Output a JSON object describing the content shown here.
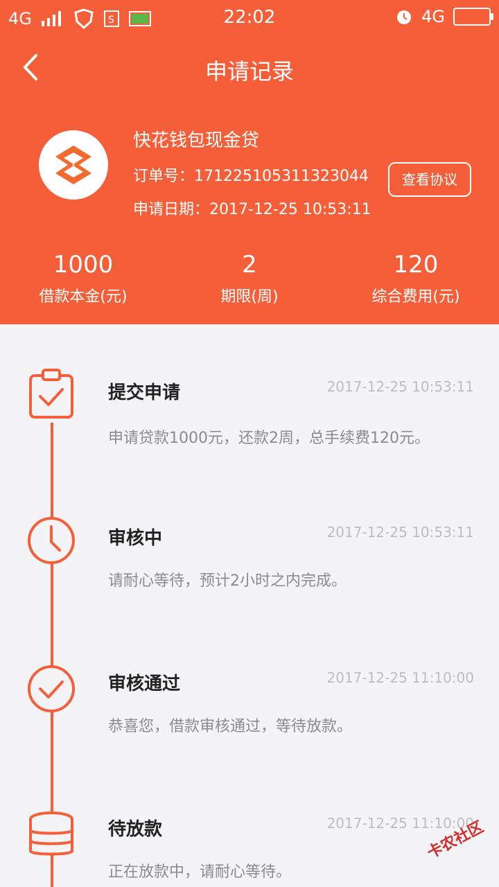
{
  "status": {
    "signal": "4G",
    "time": "22:02",
    "right_net": "4G"
  },
  "nav": {
    "title": "申请记录"
  },
  "product": {
    "name": "快花钱包现金贷",
    "order": "订单号：171225105311323044",
    "date": "申请日期：2017-12-25 10:53:11",
    "agreement_label": "查看协议"
  },
  "stats": [
    {
      "value": "1000",
      "label": "借款本金(元)"
    },
    {
      "value": "2",
      "label": "期限(周)"
    },
    {
      "value": "120",
      "label": "综合费用(元)"
    }
  ],
  "timeline": [
    {
      "title": "提交申请",
      "time": "2017-12-25 10:53:11",
      "desc": "申请贷款1000元，还款2周，总手续费120元。"
    },
    {
      "title": "审核中",
      "time": "2017-12-25 10:53:11",
      "desc": "请耐心等待，预计2小时之内完成。"
    },
    {
      "title": "审核通过",
      "time": "2017-12-25 11:10:00",
      "desc": "恭喜您，借款审核通过，等待放款。"
    },
    {
      "title": "待放款",
      "time": "2017-12-25 11:10:00",
      "desc": "正在放款中，请耐心等待。"
    }
  ],
  "watermark": "卡农社区",
  "colors": {
    "accent": "#f45f3a"
  }
}
